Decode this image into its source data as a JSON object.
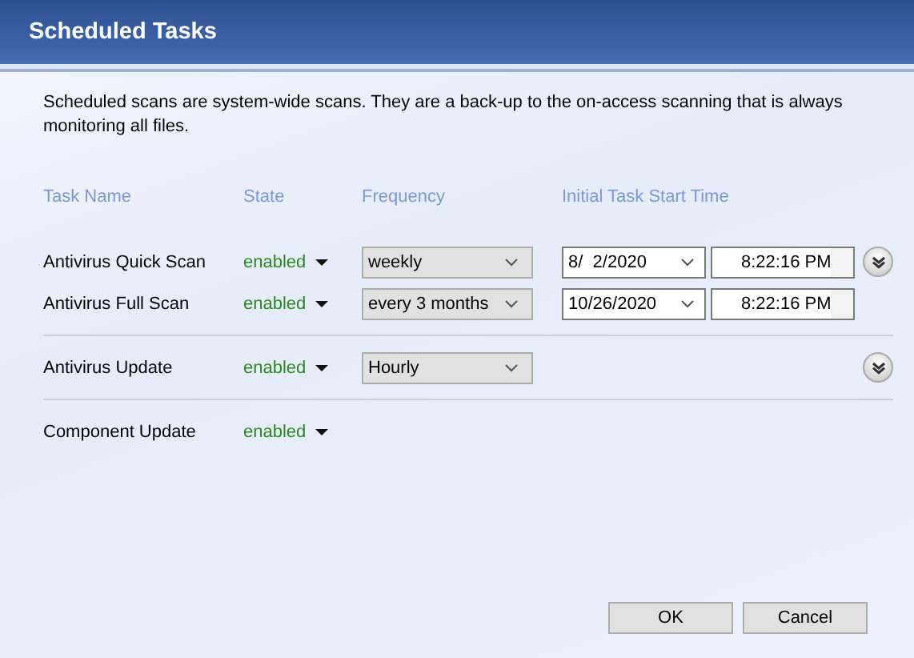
{
  "window": {
    "title": "Scheduled Tasks"
  },
  "description": "Scheduled scans are system-wide scans. They are a back-up to the on-access scanning that is always monitoring all files.",
  "columns": [
    "Task Name",
    "State",
    "Frequency",
    "Initial Task Start Time"
  ],
  "groups": [
    {
      "expand_button": true,
      "tasks": [
        {
          "name": "Antivirus Quick Scan",
          "state": "enabled",
          "frequency": "weekly",
          "date": "8/  2/2020",
          "time": "8:22:16 PM"
        },
        {
          "name": "Antivirus Full Scan",
          "state": "enabled",
          "frequency": "every 3 months",
          "date": "10/26/2020",
          "time": "8:22:16 PM"
        }
      ]
    },
    {
      "expand_button": true,
      "tasks": [
        {
          "name": "Antivirus Update",
          "state": "enabled",
          "frequency": "Hourly"
        }
      ]
    },
    {
      "expand_button": false,
      "tasks": [
        {
          "name": "Component Update",
          "state": "enabled"
        }
      ]
    }
  ],
  "buttons": [
    "OK",
    "Cancel"
  ]
}
